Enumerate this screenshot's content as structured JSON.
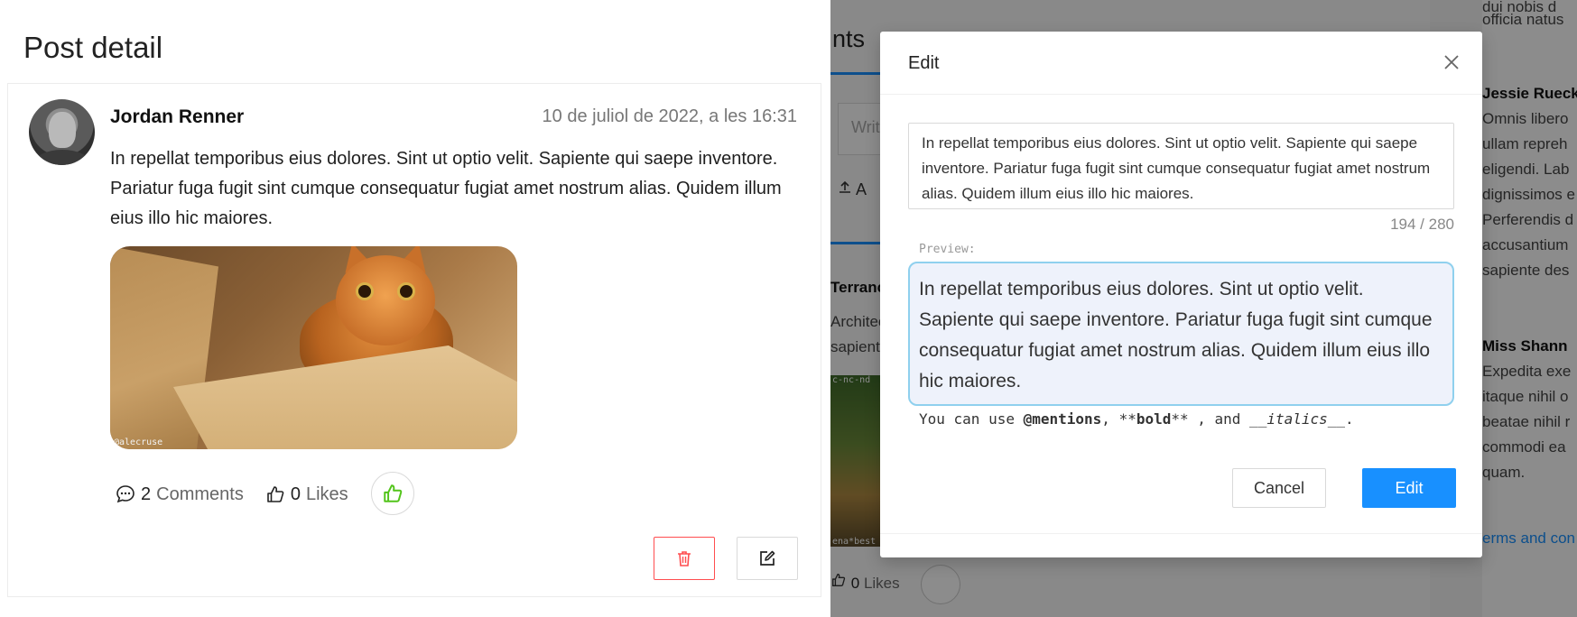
{
  "drawer": {
    "title": "Post detail"
  },
  "post": {
    "author": "Jordan Renner",
    "timestamp": "10 de juliol de 2022, a les 16:31",
    "body": "In repellat temporibus eius dolores. Sint ut optio velit. Sapiente qui saepe inventore. Pariatur fuga fugit sint cumque consequatur fugiat amet nostrum alias. Quidem illum eius illo hic maiores.",
    "image_credit": "@alecruse",
    "comments_count": "2",
    "comments_label": "Comments",
    "likes_count": "0",
    "likes_label": "Likes"
  },
  "background": {
    "tab_title_fragment": "nts",
    "input_placeholder_fragment": "Write",
    "upload_fragment": "A",
    "top_text_fragment1": "dui nobis d",
    "top_text_fragment2": "officia natus",
    "comment1_author": "Jessie Rueck",
    "comment1_lines": [
      "Omnis libero",
      "ullam repreh",
      "eligendi. Lab",
      "dignissimos e",
      "Perferendis d",
      "accusantium",
      "sapiente des"
    ],
    "comment2_author": "Miss Shann",
    "comment2_lines": [
      "Expedita exe",
      "itaque nihil o",
      "beatae nihil r",
      "commodi ea",
      "quam."
    ],
    "post2_author": "Terranc",
    "post2_lines": [
      "Architec",
      "sapient"
    ],
    "photo_credit_top": "c-nc-nd",
    "photo_credit_bottom": "ena*best",
    "likes_count": "0",
    "likes_label": "Likes",
    "terms_fragment": "erms and con"
  },
  "modal": {
    "title": "Edit",
    "textarea_value": "In repellat temporibus eius dolores. Sint ut optio velit. Sapiente qui saepe inventore. Pariatur fuga fugit sint cumque consequatur fugiat amet nostrum alias. Quidem illum eius illo hic maiores.",
    "char_count": "194 / 280",
    "preview_label": "Preview:",
    "preview_text": "In repellat temporibus eius dolores. Sint ut optio velit. Sapiente qui saepe inventore. Pariatur fuga fugit sint cumque consequatur fugiat amet nostrum alias. Quidem illum eius illo hic maiores.",
    "hint_prefix": "You can use ",
    "hint_mentions": "@mentions",
    "hint_sep1": ", **",
    "hint_bold": "bold",
    "hint_sep2": "** , and __",
    "hint_italics": "italics",
    "hint_suffix": "__.",
    "cancel_label": "Cancel",
    "submit_label": "Edit"
  },
  "colors": {
    "primary": "#1890ff",
    "danger": "#ff4d4f",
    "like_green": "#52c41a",
    "preview_border": "#8fd0ee"
  },
  "icons": [
    "comment-icon",
    "like-icon",
    "thumbs-up-icon",
    "delete-icon",
    "edit-icon",
    "close-icon",
    "upload-icon"
  ]
}
